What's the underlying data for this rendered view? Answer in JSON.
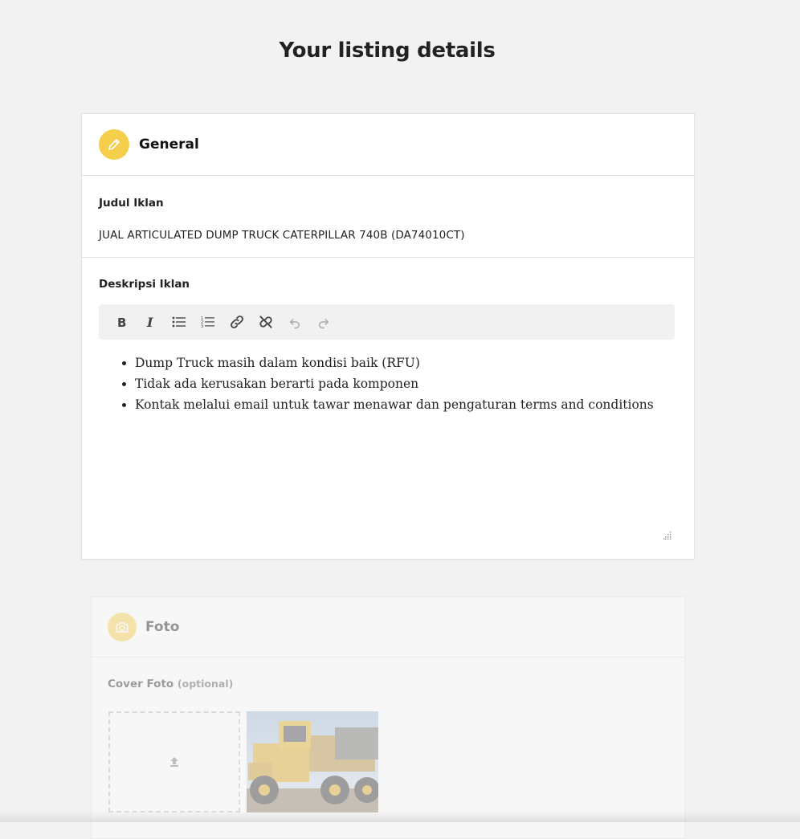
{
  "page": {
    "title": "Your listing details"
  },
  "general": {
    "header_title": "General",
    "header_icon": "pencil-icon",
    "accent_color": "#f5cf4b",
    "judul_label": "Judul Iklan",
    "judul_value": "JUAL ARTICULATED DUMP TRUCK CATERPILLAR 740B (DA74010CT)",
    "deskripsi_label": "Deskripsi Iklan",
    "toolbar": [
      {
        "name": "bold-button",
        "icon": "bold-icon"
      },
      {
        "name": "italic-button",
        "icon": "italic-icon"
      },
      {
        "name": "bullet-list-button",
        "icon": "bullet-list-icon"
      },
      {
        "name": "numbered-list-button",
        "icon": "numbered-list-icon"
      },
      {
        "name": "link-button",
        "icon": "link-icon"
      },
      {
        "name": "unlink-button",
        "icon": "unlink-icon"
      },
      {
        "name": "undo-button",
        "icon": "undo-icon"
      },
      {
        "name": "redo-button",
        "icon": "redo-icon"
      }
    ],
    "description_items": [
      "Dump Truck masih dalam kondisi baik (RFU)",
      "Tidak ada kerusakan berarti pada komponen",
      "Kontak melalui email untuk tawar menawar dan pengaturan terms and conditions"
    ]
  },
  "foto": {
    "header_title": "Foto",
    "header_icon": "camera-icon",
    "cover_label": "Cover Foto",
    "cover_optional": "(optional)",
    "upload_icon": "upload-arrow-icon",
    "photo_subject": "yellow articulated dump truck"
  }
}
